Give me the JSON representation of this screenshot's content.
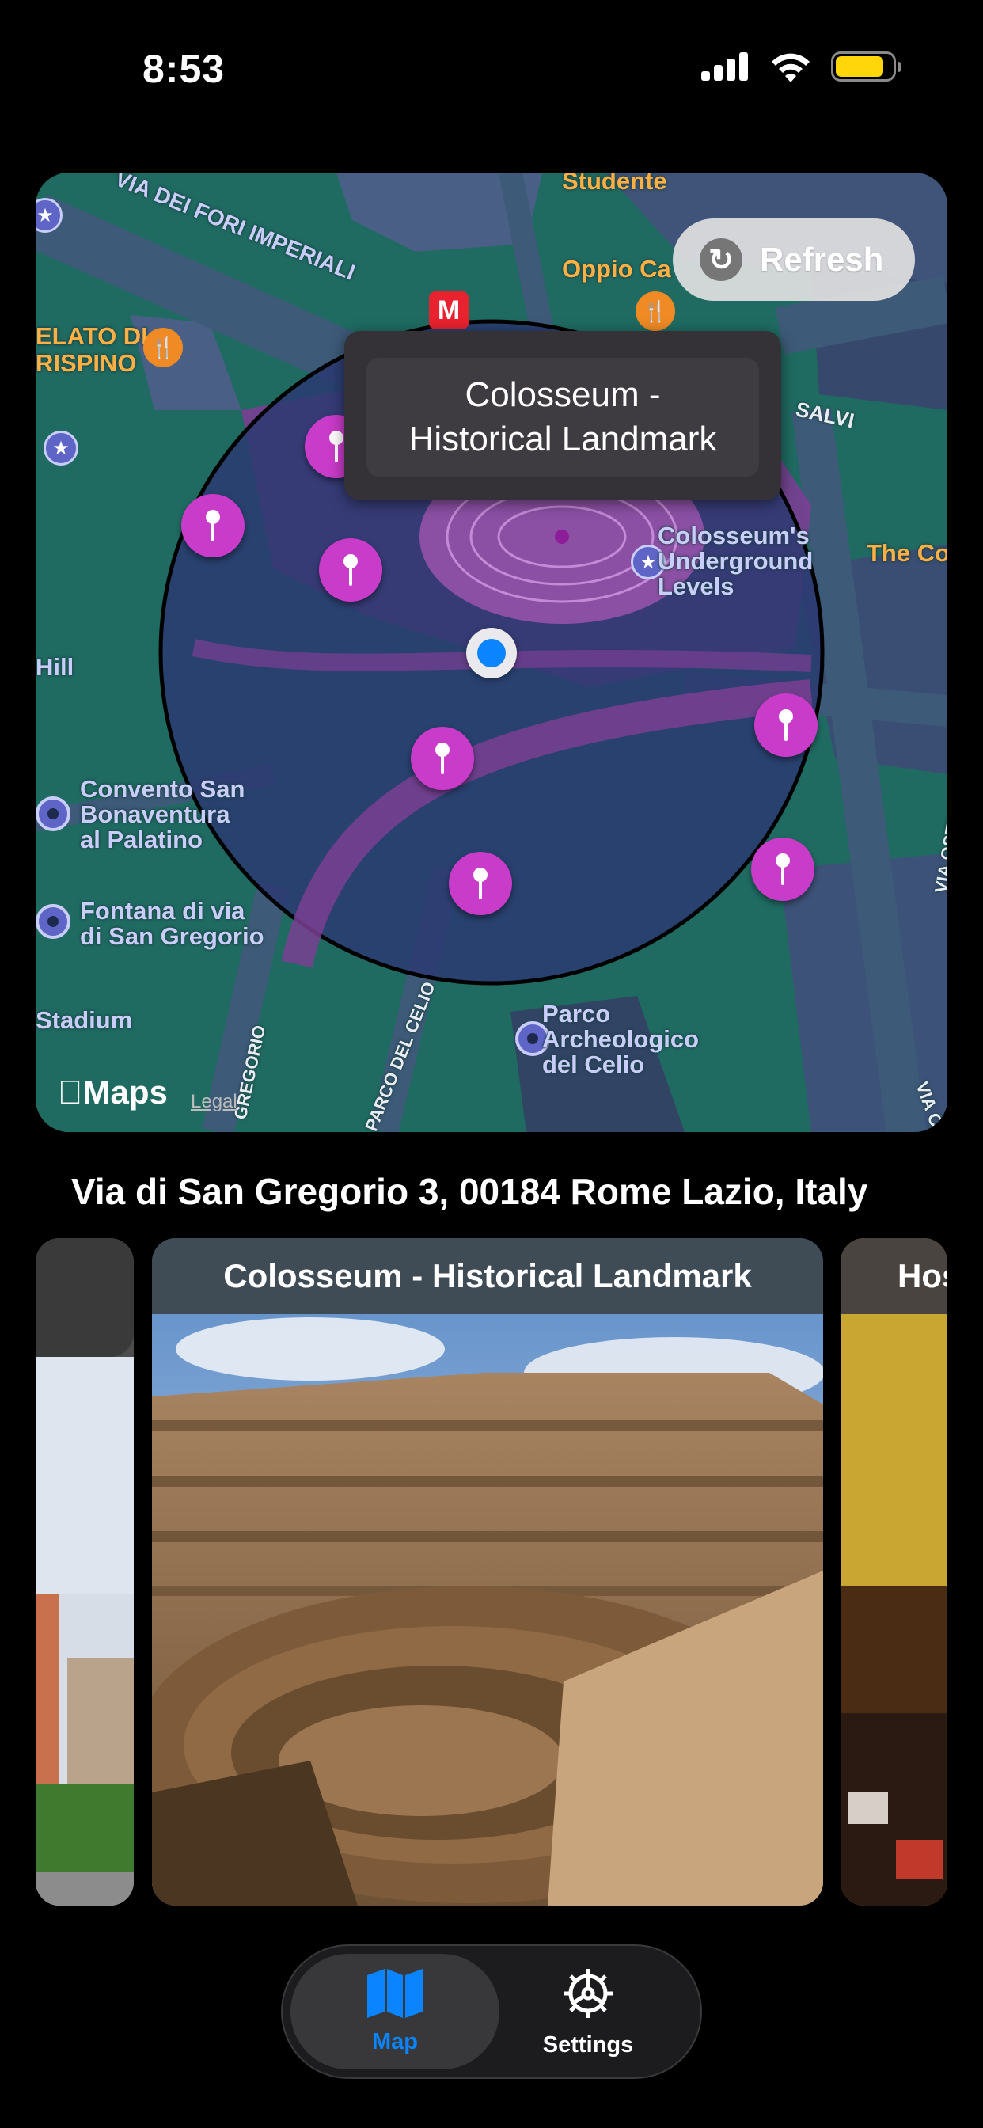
{
  "status_bar": {
    "time": "8:53",
    "battery_level": 0.85
  },
  "map": {
    "refresh_label": "Refresh",
    "callout_line1": "Colosseum -",
    "callout_line2": "Historical Landmark",
    "labels": {
      "fori_imperiali": "VIA DEI FORI IMPERIALI",
      "studente": "Studente",
      "oppio": "Oppio Ca",
      "gelato_1": "ELATO DI",
      "gelato_2": "RISPINO",
      "salvi": "SALVI",
      "colosseum_under_1": "Colosseum's",
      "colosseum_under_2": "Underground",
      "colosseum_under_3": "Levels",
      "the_co": "The Co",
      "hill": "Hill",
      "convento_1": "Convento San",
      "convento_2": "Bonaventura",
      "convento_3": "al Palatino",
      "fontana_1": "Fontana di via",
      "fontana_2": "di San Gregorio",
      "stadium": "Stadium",
      "parco_1": "Parco",
      "parco_2": "Archeologico",
      "parco_3": "del Celio",
      "via_celio": "PARCO DEL CELIO",
      "gregorio": "GREGORIO",
      "via_ostilia": "VIA OSTILIA",
      "via_c": "VIA C"
    },
    "attribution": "Maps",
    "legal": "Legal"
  },
  "address": "Via di San Gregorio 3, 00184 Rome Lazio, Italy",
  "carousel": {
    "main_title": "Colosseum - Historical Landmark",
    "right_title": "Hos"
  },
  "tab_bar": {
    "map_label": "Map",
    "settings_label": "Settings"
  },
  "colors": {
    "accent": "#0a84ff",
    "pin": "#c93bc9",
    "map_park": "#1f6b62",
    "map_road": "#3d5a78"
  },
  "icons": [
    "signal-icon",
    "wifi-icon",
    "battery-icon",
    "refresh-icon",
    "map-pin-icon",
    "metro-icon",
    "restaurant-icon",
    "star-icon",
    "apple-logo-icon",
    "map-icon",
    "gear-icon"
  ]
}
